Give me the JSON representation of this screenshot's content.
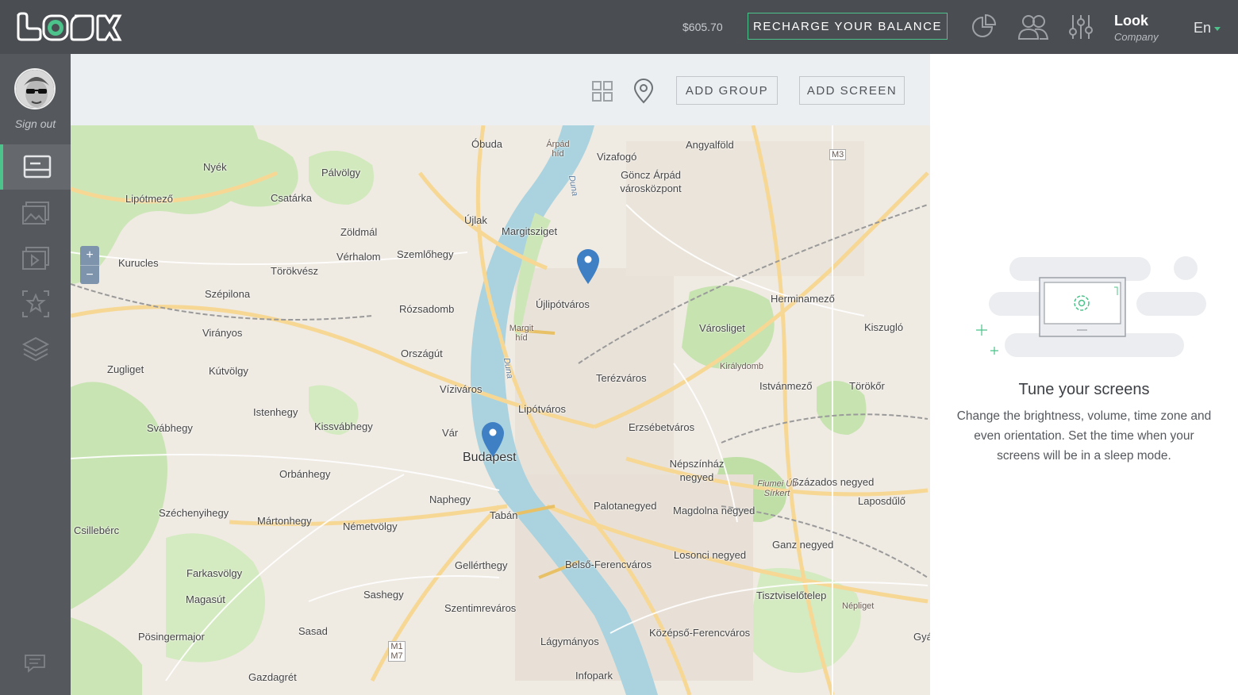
{
  "header": {
    "logo_text": "LOOK",
    "balance": "$605.70",
    "recharge_label": "RECHARGE YOUR BALANCE",
    "user_name": "Look",
    "user_role": "Company",
    "language": "En",
    "icons": [
      "statistics-icon",
      "users-icon",
      "settings-sliders-icon"
    ]
  },
  "sidebar": {
    "signout_label": "Sign out",
    "items": [
      "screens-icon",
      "images-icon",
      "playlists-icon",
      "favorites-icon",
      "layers-icon"
    ],
    "active_item": "screens-icon"
  },
  "toolbar": {
    "view_icons": [
      "grid-view-icon",
      "map-view-icon"
    ],
    "add_group_label": "ADD GROUP",
    "add_screen_label": "ADD SCREEN"
  },
  "map": {
    "zoom_in": "+",
    "zoom_out": "−",
    "places": {
      "obuda": "Óbuda",
      "arpad_hid": "Árpád híd",
      "vizafogo": "Vizafogó",
      "angyalfold": "Angyalföld",
      "gonczi": "Göncz Árpád városközpont",
      "nyek": "Nyék",
      "lipotmezo": "Lipótmező",
      "csatarka": "Csatárka",
      "palvolgy": "Pálvölgy",
      "ujlak": "Újlak",
      "margitsziget": "Margitsziget",
      "zoldmal": "Zöldmál",
      "verhalom": "Vérhalom",
      "szemlohegy": "Szemlőhegy",
      "kurucles": "Kurucles",
      "torokvesz": "Törökvész",
      "ujlipotvaros": "Újlipótváros",
      "herminamezo": "Herminamező",
      "szepilona": "Szépilona",
      "rozsadomb": "Rózsadomb",
      "varosliget": "Városliget",
      "kiszuglo": "Kiszugló",
      "viranyos": "Virányos",
      "margit_hid": "Margit híd",
      "orszagut": "Országút",
      "zugliget": "Zugliget",
      "kutvolgy": "Kútvölgy",
      "terezvaros": "Terézváros",
      "kiralydomb": "Királydomb",
      "istvanmezo": "Istvánmező",
      "torokor": "Törökőr",
      "vizivaros": "Víziváros",
      "lipotvaros": "Lipótváros",
      "istenhegy": "Istenhegy",
      "kissvabhegy": "Kissvábhegy",
      "erzsebetvaros": "Erzsébetváros",
      "svabhegy": "Svábhegy",
      "var": "Vár",
      "budapest": "Budapest",
      "nepszinhaz": "Népszínház negyed",
      "orbanhegy": "Orbánhegy",
      "szazados": "Százados negyed",
      "laposdulo": "Laposdűlő",
      "naphegy": "Naphegy",
      "palotanegyed": "Palotanegyed",
      "magdolna": "Magdolna negyed",
      "szechenyihegy": "Széchenyihegy",
      "martonhegy": "Mártonhegy",
      "tabán": "Tabán",
      "nemetvolgy": "Németvölgy",
      "csillebérc": "Csillebérc",
      "ganz": "Ganz negyed",
      "losonci": "Losonci negyed",
      "gellerthegy": "Gellérthegy",
      "belso_ferencvaros": "Belső-Ferencváros",
      "farkasvolgy": "Farkasvölgy",
      "sashegy": "Sashegy",
      "magasut": "Magasút",
      "szentimrevaros": "Szentimreváros",
      "tisztviselotelep": "Tisztviselőtelep",
      "posingermajor": "Pösingermajor",
      "sasad": "Sasad",
      "lagymanyos": "Lágymányos",
      "kozepso_ferencvaros": "Középső-Ferencváros",
      "gazdagret": "Gazdagrét",
      "infopark": "Infopark",
      "duna": "Duna",
      "nepliget": "Népliget",
      "fiumei": "Fiumei Úti Sírkert",
      "gyar": "Gyár",
      "m3": "M3",
      "m1m7": "M1 M7"
    }
  },
  "panel": {
    "title": "Tune your screens",
    "text": "Change the brightness, volume, time zone and even orientation. Set the time when your screens will be in a sleep mode."
  },
  "colors": {
    "accent": "#4cc38a",
    "topbar": "#4a4d52",
    "sidebar": "#55585d",
    "map_pin": "#3f7fc4",
    "river": "#aad3df"
  }
}
